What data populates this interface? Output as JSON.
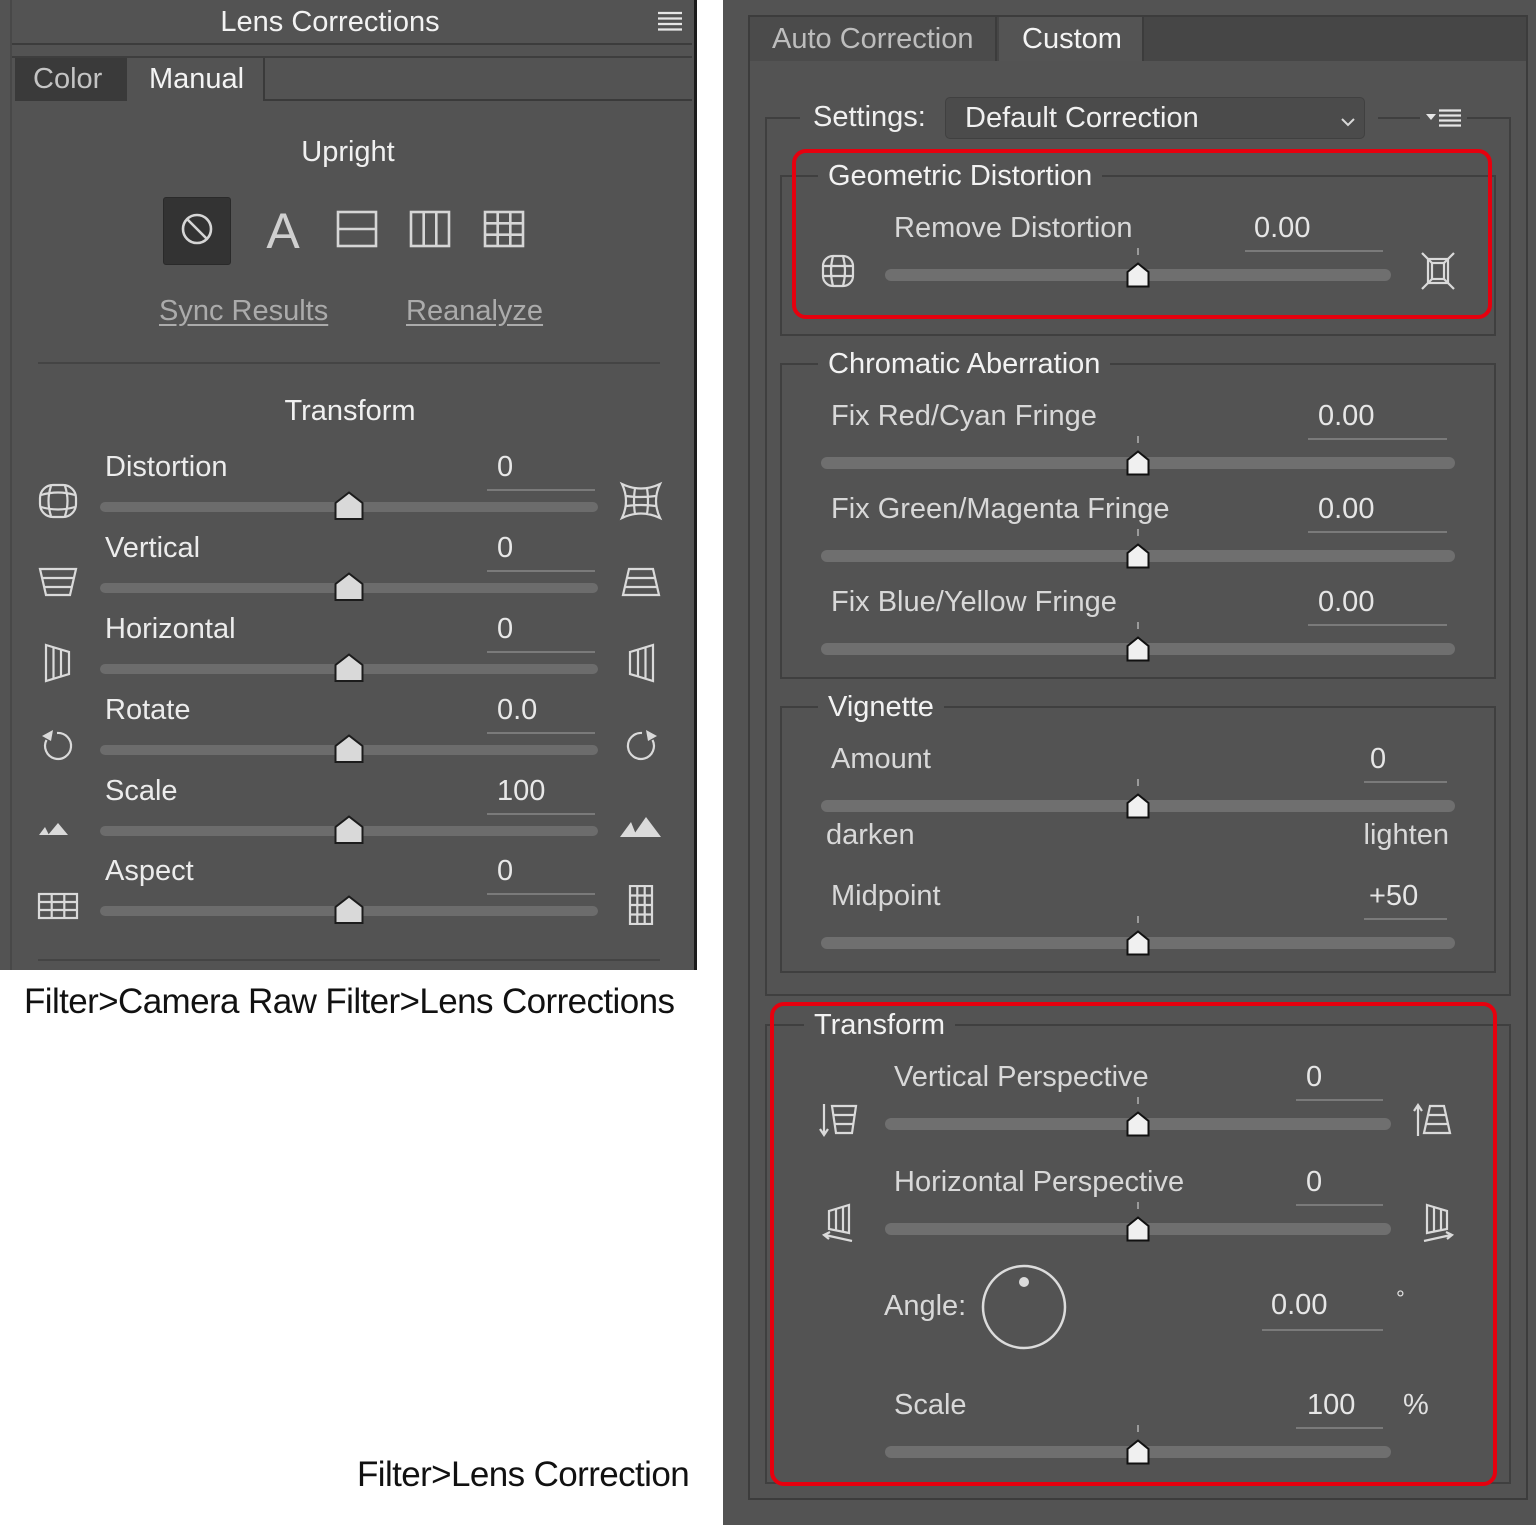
{
  "colors": {
    "panel_bg": "#535353",
    "highlight_border": "#e6000e",
    "text": "#ececec",
    "link": "#ababab",
    "slider_track": "#6c6c6c"
  },
  "camera_raw": {
    "title": "Lens Corrections",
    "menu_icon": "panel-menu-icon",
    "tabs": [
      {
        "label": "Color",
        "active": false
      },
      {
        "label": "Manual",
        "active": true
      }
    ],
    "upright": {
      "heading": "Upright",
      "modes": [
        {
          "name": "Off",
          "icon": "no-sign-icon",
          "selected": true
        },
        {
          "name": "Auto",
          "icon": "letter-a-icon",
          "glyph": "A",
          "selected": false
        },
        {
          "name": "Level",
          "icon": "level-icon",
          "selected": false
        },
        {
          "name": "Vertical",
          "icon": "vertical-lines-icon",
          "selected": false
        },
        {
          "name": "Full",
          "icon": "full-grid-icon",
          "selected": false
        }
      ],
      "sync_results": "Sync Results",
      "reanalyze": "Reanalyze"
    },
    "transform": {
      "heading": "Transform",
      "sliders": [
        {
          "label": "Distortion",
          "value": "0",
          "position": 0.5,
          "left_icon": "barrel-distortion-icon",
          "right_icon": "pincushion-distortion-icon"
        },
        {
          "label": "Vertical",
          "value": "0",
          "position": 0.5,
          "left_icon": "vertical-perspective-in-icon",
          "right_icon": "vertical-perspective-out-icon"
        },
        {
          "label": "Horizontal",
          "value": "0",
          "position": 0.5,
          "left_icon": "horizontal-perspective-left-icon",
          "right_icon": "horizontal-perspective-right-icon"
        },
        {
          "label": "Rotate",
          "value": "0.0",
          "position": 0.5,
          "left_icon": "rotate-left-icon",
          "right_icon": "rotate-right-icon"
        },
        {
          "label": "Scale",
          "value": "100",
          "position": 0.5,
          "left_icon": "scale-small-icon",
          "right_icon": "scale-large-icon"
        },
        {
          "label": "Aspect",
          "value": "0",
          "position": 0.5,
          "left_icon": "aspect-wide-icon",
          "right_icon": "aspect-tall-icon"
        }
      ]
    },
    "caption": "Filter>Camera Raw Filter>Lens Corrections"
  },
  "lens_correction": {
    "tabs": [
      {
        "label": "Auto Correction",
        "active": false
      },
      {
        "label": "Custom",
        "active": true
      }
    ],
    "settings": {
      "label": "Settings:",
      "selected": "Default Correction",
      "menu_icon": "settings-menu-icon"
    },
    "geometric_distortion": {
      "heading": "Geometric Distortion",
      "highlighted": true,
      "sliders": [
        {
          "label": "Remove Distortion",
          "value": "0.00",
          "position": 0.5,
          "left_icon": "pincushion-grid-icon",
          "right_icon": "barrel-box-icon"
        }
      ]
    },
    "chromatic_aberration": {
      "heading": "Chromatic Aberration",
      "sliders": [
        {
          "label": "Fix Red/Cyan Fringe",
          "value": "0.00",
          "position": 0.5
        },
        {
          "label": "Fix Green/Magenta Fringe",
          "value": "0.00",
          "position": 0.5
        },
        {
          "label": "Fix Blue/Yellow Fringe",
          "value": "0.00",
          "position": 0.5
        }
      ]
    },
    "vignette": {
      "heading": "Vignette",
      "amount": {
        "label": "Amount",
        "value": "0",
        "position": 0.5
      },
      "darken": "darken",
      "lighten": "lighten",
      "midpoint": {
        "label": "Midpoint",
        "value": "+50",
        "position": 0.5
      }
    },
    "transform": {
      "heading": "Transform",
      "highlighted": true,
      "vertical_perspective": {
        "label": "Vertical Perspective",
        "value": "0",
        "position": 0.5
      },
      "horizontal_perspective": {
        "label": "Horizontal Perspective",
        "value": "0",
        "position": 0.5
      },
      "angle": {
        "label": "Angle:",
        "value": "0.00",
        "unit": "°",
        "degrees": 0
      },
      "scale": {
        "label": "Scale",
        "value": "100",
        "unit": "%",
        "position": 0.5
      }
    },
    "caption": "Filter>Lens Correction"
  }
}
